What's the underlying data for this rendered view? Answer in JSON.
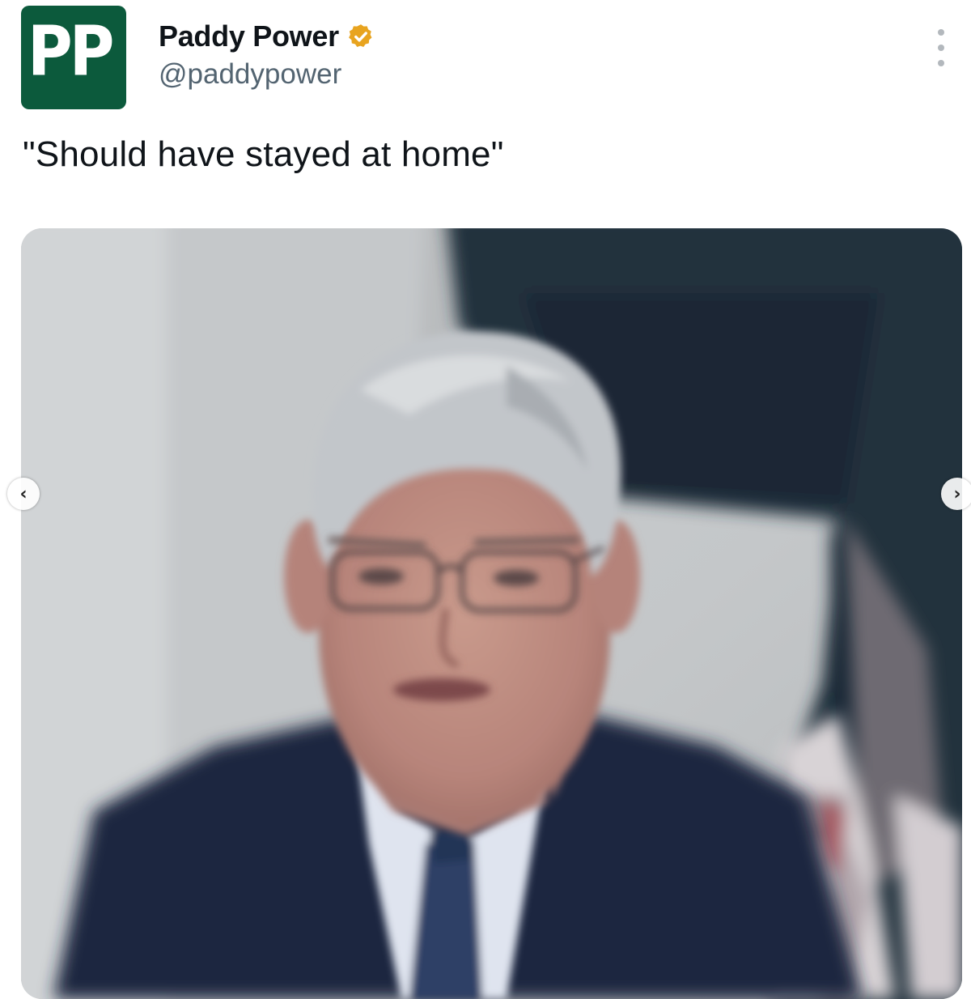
{
  "account": {
    "display_name": "Paddy Power",
    "handle": "@paddypower",
    "verified": true,
    "avatar_logo_text": "PP",
    "avatar_color": "#0c5a3c",
    "verified_badge_color": "#e8a41f"
  },
  "tweet": {
    "text": "\"Should have stayed at home\""
  },
  "menu": {
    "icon": "more-vertical-icon"
  },
  "carousel": {
    "prev_icon": "chevron-left-icon",
    "next_icon": "chevron-right-icon",
    "prev_glyph": "‹",
    "next_glyph": "›"
  }
}
